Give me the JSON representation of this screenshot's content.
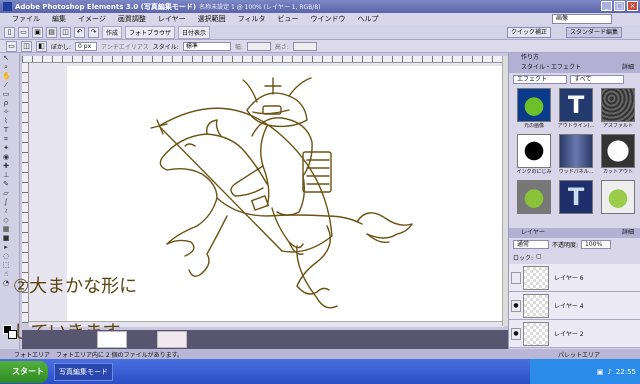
{
  "window": {
    "title": "Adobe Photoshop Elements 3.0 (写真編集モード)",
    "file": "名称未設定 1 @ 100% (レイヤー 1, RGB/8)"
  },
  "menu": [
    "ファイル",
    "編集",
    "イメージ",
    "画質調整",
    "レイヤー",
    "選択範囲",
    "フィルタ",
    "ビュー",
    "ウインドウ",
    "ヘルプ"
  ],
  "help_field": "画像",
  "toolbar": {
    "create": "作成",
    "photo_browser": "フォトブラウザ",
    "date_view": "日付表示",
    "quick_fix": "クイック補正",
    "standard_edit": "スタンダード編集"
  },
  "options": {
    "feather_label": "ぼかし:",
    "feather_value": "0 px",
    "antialias": "アンチエイリアス",
    "style_label": "スタイル:",
    "style_value": "標準",
    "width_label": "幅:",
    "height_label": "高さ:"
  },
  "caption": {
    "line1": "②大まかな形に",
    "line2": "していきます。"
  },
  "palettes": {
    "how_to": "作り方",
    "styles": "スタイル・エフェクト",
    "more": "詳細",
    "effects_select": "エフェクト",
    "all_select": "すべて",
    "thumbs": [
      {
        "label": "元の画像",
        "img": "photo-apple"
      },
      {
        "label": "アウトライン(...",
        "img": "text-outline-t"
      },
      {
        "label": "アスファルト",
        "img": "asphalt-texture"
      },
      {
        "label": "インクのにじみ",
        "img": "ink-blot"
      },
      {
        "label": "ウッドパネル...",
        "img": "wood-panel"
      },
      {
        "label": "カットアウト",
        "img": "cutout"
      },
      {
        "label": "",
        "img": "apple-1"
      },
      {
        "label": "",
        "img": "text-glow-t"
      },
      {
        "label": "",
        "img": "apple-2"
      }
    ],
    "layers": "レイヤー",
    "blend_mode": "通常",
    "opacity_label": "不透明度:",
    "opacity": "100%",
    "lock_label": "ロック:",
    "layer_items": [
      {
        "name": "レイヤー 6",
        "visible": false
      },
      {
        "name": "レイヤー 4",
        "visible": true
      },
      {
        "name": "レイヤー 2",
        "visible": true
      }
    ]
  },
  "status": {
    "photo_bin": "フォトエリア",
    "photo_bin_info": "フォトエリア内に 2 個のファイルがあります。",
    "palette_bin": "パレットエリア"
  },
  "taskbar": {
    "start": "スタート",
    "task": "写真編集モード",
    "clock": "22:55"
  },
  "colors": {
    "ink": "#6b5313",
    "caption": "#5a4510",
    "title": "#5a64a8"
  }
}
